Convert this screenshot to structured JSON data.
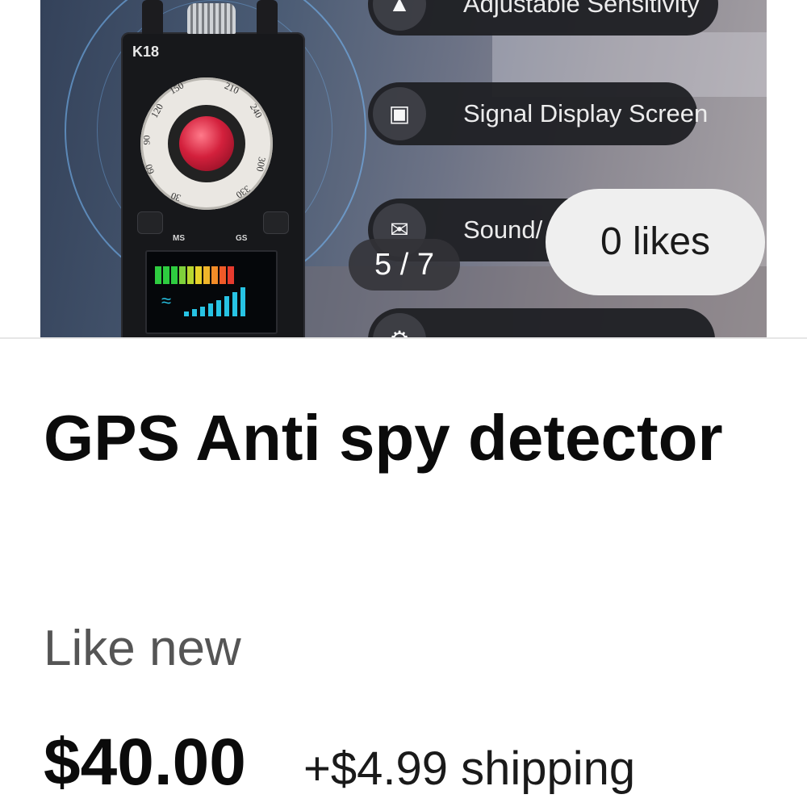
{
  "gallery": {
    "device_model": "K18",
    "dial_ticks": [
      "150",
      "210",
      "240",
      "300",
      "330",
      "30",
      "60",
      "90",
      "120"
    ],
    "button_labels": [
      "MS",
      "GS"
    ],
    "features": [
      {
        "label": "Adjustable Sensitivity",
        "icon": "antenna-signal-icon"
      },
      {
        "label": "Signal Display Screen",
        "icon": "signal-screen-icon"
      },
      {
        "label": "Sound/",
        "icon": "speaker-vibrate-icon"
      },
      {
        "label": "",
        "icon": "settings-icon"
      }
    ],
    "image_counter": "5 / 7",
    "likes_label": "0 likes"
  },
  "listing": {
    "title": "GPS Anti spy detector",
    "condition": "Like new",
    "price": "$40.00",
    "shipping": "+$4.99 shipping"
  },
  "colors": {
    "text_primary": "#0b0b0b",
    "text_secondary": "#555555",
    "lens_red": "#d3203c",
    "screen_cyan": "#27c3e4"
  }
}
